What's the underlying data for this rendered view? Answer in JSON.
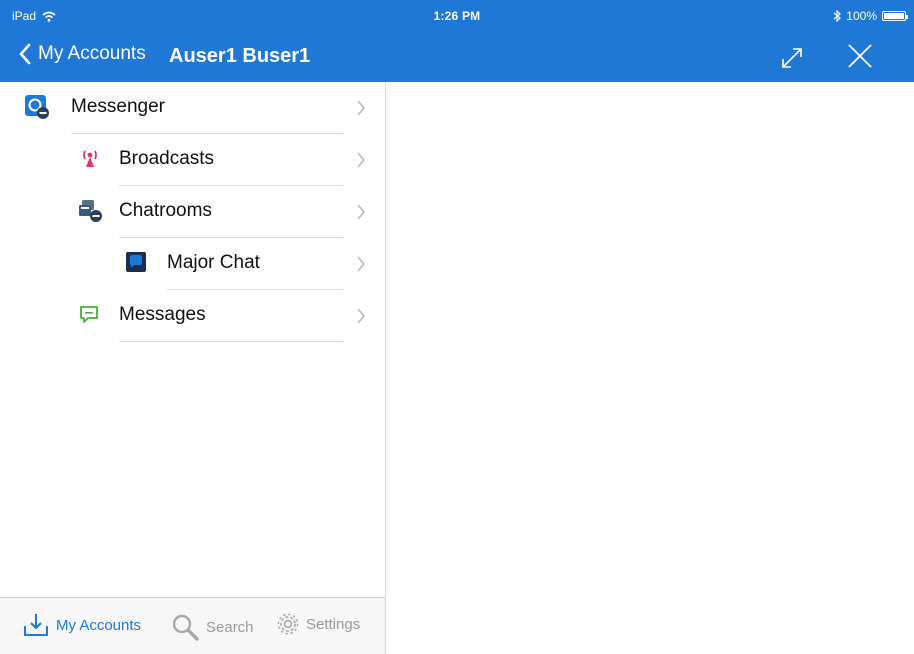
{
  "status": {
    "device": "iPad",
    "time": "1:26 PM",
    "battery": "100%"
  },
  "nav": {
    "back_label": "My Accounts",
    "title": "Auser1 Buser1"
  },
  "sidebar": {
    "items": [
      {
        "label": "Messenger",
        "icon": "messenger-icon"
      },
      {
        "label": "Broadcasts",
        "icon": "broadcast-tower-icon"
      },
      {
        "label": "Chatrooms",
        "icon": "chatrooms-icon"
      },
      {
        "label": "Major Chat",
        "icon": "chat-bubble-icon"
      },
      {
        "label": "Messages",
        "icon": "message-icon"
      }
    ]
  },
  "tabs": [
    {
      "label": "My Accounts",
      "icon": "accounts-download-icon",
      "active": true
    },
    {
      "label": "Search",
      "icon": "search-icon",
      "active": false
    },
    {
      "label": "Settings",
      "icon": "gear-icon",
      "active": false
    }
  ],
  "colors": {
    "accent": "#1f78d6",
    "broadcast": "#e8336a",
    "messages": "#4aae3a",
    "icon_dark": "#3c5a80"
  }
}
